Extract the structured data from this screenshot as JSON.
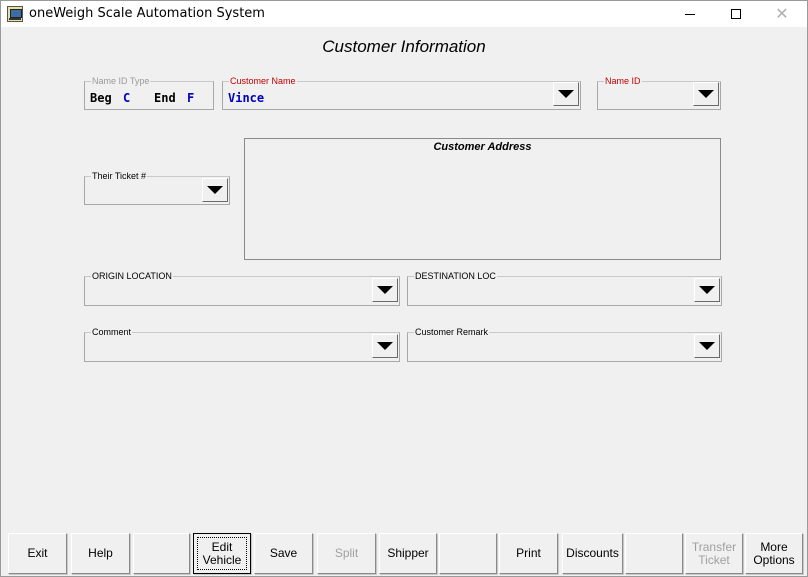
{
  "window": {
    "title": "oneWeigh Scale Automation System",
    "close_glyph": "✕"
  },
  "form": {
    "heading": "Customer Information",
    "name_id_type": {
      "label": "Name ID Type",
      "beg_label": "Beg",
      "beg_value": "C",
      "end_label": "End",
      "end_value": "F"
    },
    "customer_name": {
      "label": "Customer Name",
      "value": "Vince"
    },
    "name_id": {
      "label": "Name ID",
      "value": ""
    },
    "their_ticket": {
      "label": "Their Ticket #",
      "value": ""
    },
    "customer_address": {
      "label": "Customer Address"
    },
    "origin_location": {
      "label": "ORIGIN LOCATION",
      "value": ""
    },
    "destination_loc": {
      "label": "DESTINATION LOC",
      "value": ""
    },
    "comment": {
      "label": "Comment",
      "value": ""
    },
    "customer_remark": {
      "label": "Customer Remark",
      "value": ""
    }
  },
  "footer": {
    "exit": "Exit",
    "help": "Help",
    "edit_vehicle": "Edit\nVehicle",
    "save": "Save",
    "split": "Split",
    "shipper": "Shipper",
    "print": "Print",
    "discounts": "Discounts",
    "transfer_ticket": "Transfer\nTicket",
    "more_options": "More\nOptions"
  },
  "colors": {
    "accent_red": "#c00000",
    "value_blue": "#0000c0"
  }
}
